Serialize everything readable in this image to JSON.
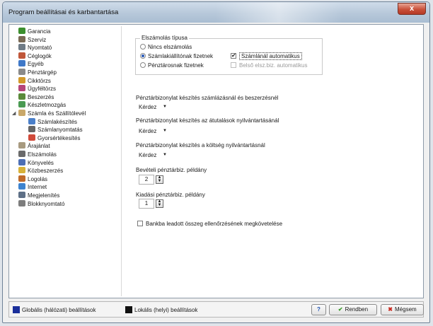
{
  "window": {
    "title": "Program beállításai és karbantartása",
    "close_label": "x"
  },
  "tree": [
    {
      "label": "Garancia",
      "icon": "guarantee-icon",
      "color": "#3c8f2e"
    },
    {
      "label": "Szerviz",
      "icon": "service-icon",
      "color": "#7a6a55"
    },
    {
      "label": "Nyomtató",
      "icon": "printer-icon",
      "color": "#6f7b86"
    },
    {
      "label": "Céglogók",
      "icon": "logo-icon",
      "color": "#c0573a"
    },
    {
      "label": "Egyéb",
      "icon": "misc-icon",
      "color": "#3f78c8"
    },
    {
      "label": "Pénztárgép",
      "icon": "cash-register-icon",
      "color": "#8a8a8a"
    },
    {
      "label": "Cikktörzs",
      "icon": "items-icon",
      "color": "#d39a2b"
    },
    {
      "label": "Ügyféltörzs",
      "icon": "customers-icon",
      "color": "#b6457a"
    },
    {
      "label": "Beszerzés",
      "icon": "purchase-icon",
      "color": "#5a8a3a"
    },
    {
      "label": "Készletmozgás",
      "icon": "stock-icon",
      "color": "#4a9a52"
    },
    {
      "label": "Számla és Szállítólevél",
      "icon": "invoice-icon",
      "color": "#c9a86a",
      "expanded": true
    },
    {
      "label": "Számlakészítés",
      "icon": "invoice-create-icon",
      "color": "#4a7fc9",
      "child": true
    },
    {
      "label": "Számlanyomtatás",
      "icon": "invoice-print-icon",
      "color": "#666666",
      "child": true
    },
    {
      "label": "Gyorsértékesítés",
      "icon": "quick-sale-icon",
      "color": "#d04a3a",
      "child": true
    },
    {
      "label": "Árajánlat",
      "icon": "quote-icon",
      "color": "#a89a80"
    },
    {
      "label": "Elszámolás",
      "icon": "settlement-icon",
      "color": "#6a6a6a"
    },
    {
      "label": "Könyvelés",
      "icon": "accounting-icon",
      "color": "#4d6fb5"
    },
    {
      "label": "Közbeszerzés",
      "icon": "procurement-icon",
      "color": "#d8b23a"
    },
    {
      "label": "Logolás",
      "icon": "logging-icon",
      "color": "#c06a2a"
    },
    {
      "label": "Internet",
      "icon": "internet-icon",
      "color": "#3d83cf"
    },
    {
      "label": "Megjelenítés",
      "icon": "display-icon",
      "color": "#5e6f86"
    },
    {
      "label": "Blokknyomtató",
      "icon": "receipt-printer-icon",
      "color": "#7d7d7d"
    }
  ],
  "settlement": {
    "legend": "Elszámolás típusa",
    "options": [
      {
        "label": "Nincs elszámolás",
        "selected": false
      },
      {
        "label": "Számlakiállítónak fizetnek",
        "selected": true
      },
      {
        "label": "Pénztárosnak fizetnek",
        "selected": false
      }
    ],
    "auto_invoice_label": "Számlánál automatikus",
    "auto_invoice_checked": true,
    "internal_auto_label": "Belső elsz.biz. automatikus",
    "internal_auto_checked": false
  },
  "receipt_settings": [
    {
      "label": "Pénztárbizonylat készítés számlázásnál és beszerzésnél",
      "value": "Kérdez"
    },
    {
      "label": "Pénztárbizonylat készítés az átutalások nyilvántartásánál",
      "value": "Kérdez"
    },
    {
      "label": "Pénztárbizonylat készítés a költség nyilvántartásnál",
      "value": "Kérdez"
    }
  ],
  "incoming_copies": {
    "label": "Bevételi pénztárbiz. példány",
    "value": "2"
  },
  "outgoing_copies": {
    "label": "Kiadási pénztárbiz. példány",
    "value": "1"
  },
  "bank_check": {
    "label": "Bankba leadott összeg ellenőrzésének megkövetelése",
    "checked": false
  },
  "footer": {
    "global_label": "Globális (hálózati) beállítások",
    "global_color": "#1b2f9a",
    "local_label": "Lokális (helyi) beállítások",
    "local_color": "#111111",
    "help_label": "?",
    "ok_label": "Rendben",
    "cancel_label": "Mégsem"
  }
}
